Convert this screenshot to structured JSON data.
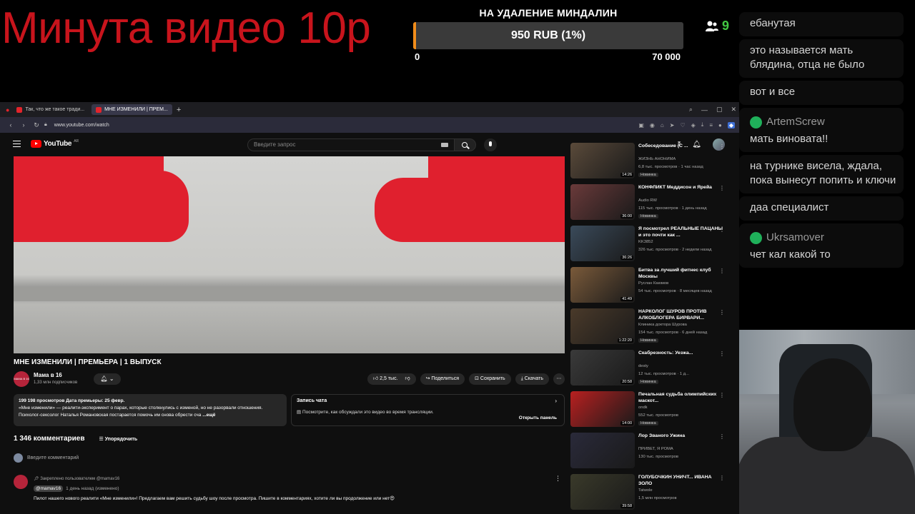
{
  "stream": {
    "title": "Минута видео 10р",
    "goal": {
      "title": "НА УДАЛЕНИЕ МИНДАЛИН",
      "progress_text": "950 RUB (1%)",
      "progress_fraction": 0.01,
      "min": "0",
      "max": "70 000"
    },
    "viewers": "9",
    "colors": {
      "title": "#c8141c",
      "goal_fill": "#f08c1a",
      "viewers": "#42c742"
    }
  },
  "chat": [
    {
      "user": "",
      "text": "ебанутая"
    },
    {
      "user": "",
      "text": "это называется мать блядина, отца не было"
    },
    {
      "user": "",
      "text": "вот и все"
    },
    {
      "user": "ArtemScrew",
      "text": "мать виновата!!"
    },
    {
      "user": "",
      "text": "на турнике висела, ждала, пока вынесут попить и ключи"
    },
    {
      "user": "",
      "text": "даа специалист"
    },
    {
      "user": "Ukrsamover",
      "text": "чет кал какой то"
    }
  ],
  "browser": {
    "tabs": [
      {
        "label": "Так, что же такое тради..."
      },
      {
        "label": "МНЕ ИЗМЕНИЛИ | ПРЕМ..."
      }
    ],
    "url": "www.youtube.com/watch"
  },
  "youtube": {
    "logo": "YouTube",
    "region": "AR",
    "search_placeholder": "Введите запрос",
    "video_title": "МНЕ ИЗМЕНИЛИ | ПРЕМЬЕРА | 1 ВЫПУСК",
    "channel": {
      "avatar_text": "МАМА В 16",
      "name": "Мама в 16",
      "subs": "1,33 млн подписчиков"
    },
    "actions": {
      "likes": "2,5 тыс.",
      "share": "Поделиться",
      "save": "Сохранить",
      "download": "Скачать"
    },
    "description": {
      "stats": "199 198 просмотров  Дата премьеры: 25 февр.",
      "text": "«Мне изменили» — реалити-эксперимент о парах, которые столкнулись с изменой, но не разорвали отношения. Психолог-сексолог Наталья Романовская постарается помочь им снова обрести сча",
      "more": "...ещё"
    },
    "chat_replay": {
      "title": "Запись чата",
      "text": "Посмотрите, как обсуждали это видео во время трансляции.",
      "open": "Открыть панель"
    },
    "comments": {
      "count": "1 346 комментариев",
      "sort": "Упорядочить",
      "add_placeholder": "Введите комментарий",
      "pinned": {
        "label": "Закреплено пользователем @mamav16",
        "author": "@mamav16",
        "time": "1 день назад (изменено)",
        "text": "Пилот нашего нового реалити «Мне изменили»! Предлагаем вам решить судьбу шоу после просмотра. Пишите в комментариях, хотите ли вы продолжение или нет😍"
      }
    },
    "recommendations": [
      {
        "title": "Собеседование (С ...",
        "channel": "ЖИЗНЬ АНОНИМА",
        "meta": "6,8 тыс. просмотров · 1 час назад",
        "badge": "Новинка",
        "duration": "14:26",
        "color": "#5a4a3a"
      },
      {
        "title": "КОНФЛИКТ Меддисон и Ярейа",
        "channel": "Audio RW",
        "meta": "115 тыс. просмотров · 1 день назад",
        "badge": "Новинка",
        "duration": "36:00",
        "color": "#6a3a3a"
      },
      {
        "title": "Я посмотрел РЕАЛЬНЫЕ ПАЦАНЫ и это почти как ...",
        "channel": "KK3852",
        "meta": "326 тыс. просмотров · 2 недели назад",
        "badge": "",
        "duration": "36:26",
        "color": "#3a4a5a"
      },
      {
        "title": "Битва за лучший фитнес клуб Москвы",
        "channel": "Руслан Каюмов",
        "meta": "54 тыс. просмотров · 8 месяцев назад",
        "badge": "",
        "duration": "41:49",
        "color": "#7a5a3a"
      },
      {
        "title": "НАРКОЛОГ ШУРОВ ПРОТИВ АЛКОБЛОГЕРА БИРВАРИ...",
        "channel": "Клиника доктора Шурова",
        "meta": "154 тыс. просмотров · 6 дней назад",
        "badge": "Новинка",
        "duration": "1:22:20",
        "color": "#4a3a2a"
      },
      {
        "title": "Скабрезность: Уезжа...",
        "channel": "desty",
        "meta": "12 тыс. просмотров · 1 д...",
        "badge": "Новинка",
        "duration": "20:58",
        "color": "#3a3a3a"
      },
      {
        "title": "Печальная судьба олимпийских маскот...",
        "channel": "ondk",
        "meta": "552 тыс. просмотров",
        "badge": "Новинка",
        "duration": "14:00",
        "color": "#b82020"
      },
      {
        "title": "Лор Званого Ужина",
        "channel": "ПРИВЕТ, Я РОМА",
        "meta": "130 тыс. просмотров",
        "badge": "",
        "duration": "",
        "color": "#2a2a3a"
      },
      {
        "title": "ГОЛУБОЧКИН УНИЧТ... ИВАНА ЗОЛО",
        "channel": "Tatwole",
        "meta": "1,5 млн просмотров",
        "badge": "",
        "duration": "39:58",
        "color": "#3a3a2a"
      }
    ]
  }
}
